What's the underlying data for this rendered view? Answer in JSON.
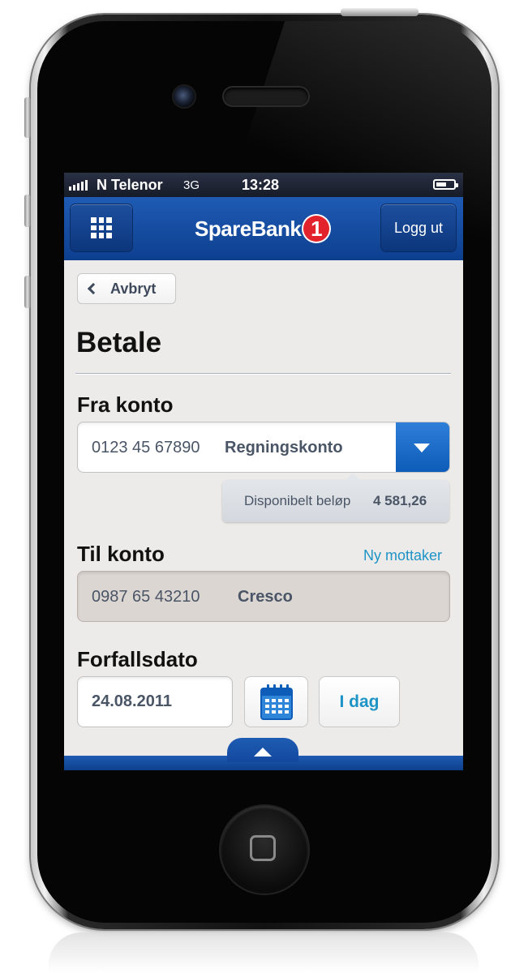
{
  "status_bar": {
    "carrier": "N Telenor",
    "network": "3G",
    "time": "13:28"
  },
  "header": {
    "logo_text": "SpareBank",
    "logo_mark": "1",
    "logout_label": "Logg ut",
    "menu_icon": "grid-menu-icon"
  },
  "nav": {
    "back_label": "Avbryt"
  },
  "page": {
    "title": "Betale"
  },
  "from_account": {
    "label": "Fra konto",
    "number": "0123 45 67890",
    "name": "Regningskonto",
    "available_label": "Disponibelt beløp",
    "available_amount": "4 581,26"
  },
  "to_account": {
    "label": "Til konto",
    "new_recipient_link": "Ny mottaker",
    "number": "0987 65 43210",
    "name": "Cresco"
  },
  "due_date": {
    "label": "Forfallsdato",
    "value": "24.08.2011",
    "today_label": "I dag"
  },
  "colors": {
    "brand_blue": "#0d3f8e",
    "accent_blue": "#1e93c6",
    "logo_red": "#e3232c"
  }
}
